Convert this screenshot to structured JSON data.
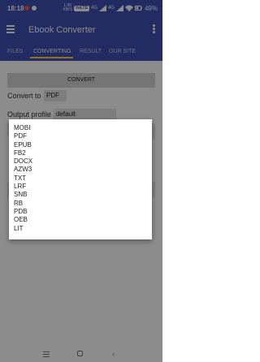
{
  "status_bar": {
    "time": "18:18",
    "speed_value": "1.00",
    "speed_unit": "KB/S",
    "network_badge": "VoLTE",
    "signal_left": "4G",
    "signal_right": "4G",
    "battery_percent": "49%"
  },
  "app_bar": {
    "title": "Ebook Converter"
  },
  "tabs": [
    "FILES",
    "CONVERTING",
    "RESULT",
    "OUR SITE"
  ],
  "active_tab": "CONVERTING",
  "main": {
    "convert_button": "CONVERT",
    "convert_to_label": "Convert to",
    "convert_to_value": "PDF",
    "output_profile_label": "Output profile",
    "output_profile_value": "default"
  },
  "dialog": {
    "options": [
      "MOBI",
      "PDF",
      "EPUB",
      "FB2",
      "DOCX",
      "AZW3",
      "TXT",
      "LRF",
      "SNB",
      "RB",
      "PDB",
      "OEB",
      "LIT"
    ]
  },
  "colors": {
    "primary": "#3f51b5",
    "tab_indicator": "#ffd740",
    "button_bg": "#d6d6d6"
  }
}
